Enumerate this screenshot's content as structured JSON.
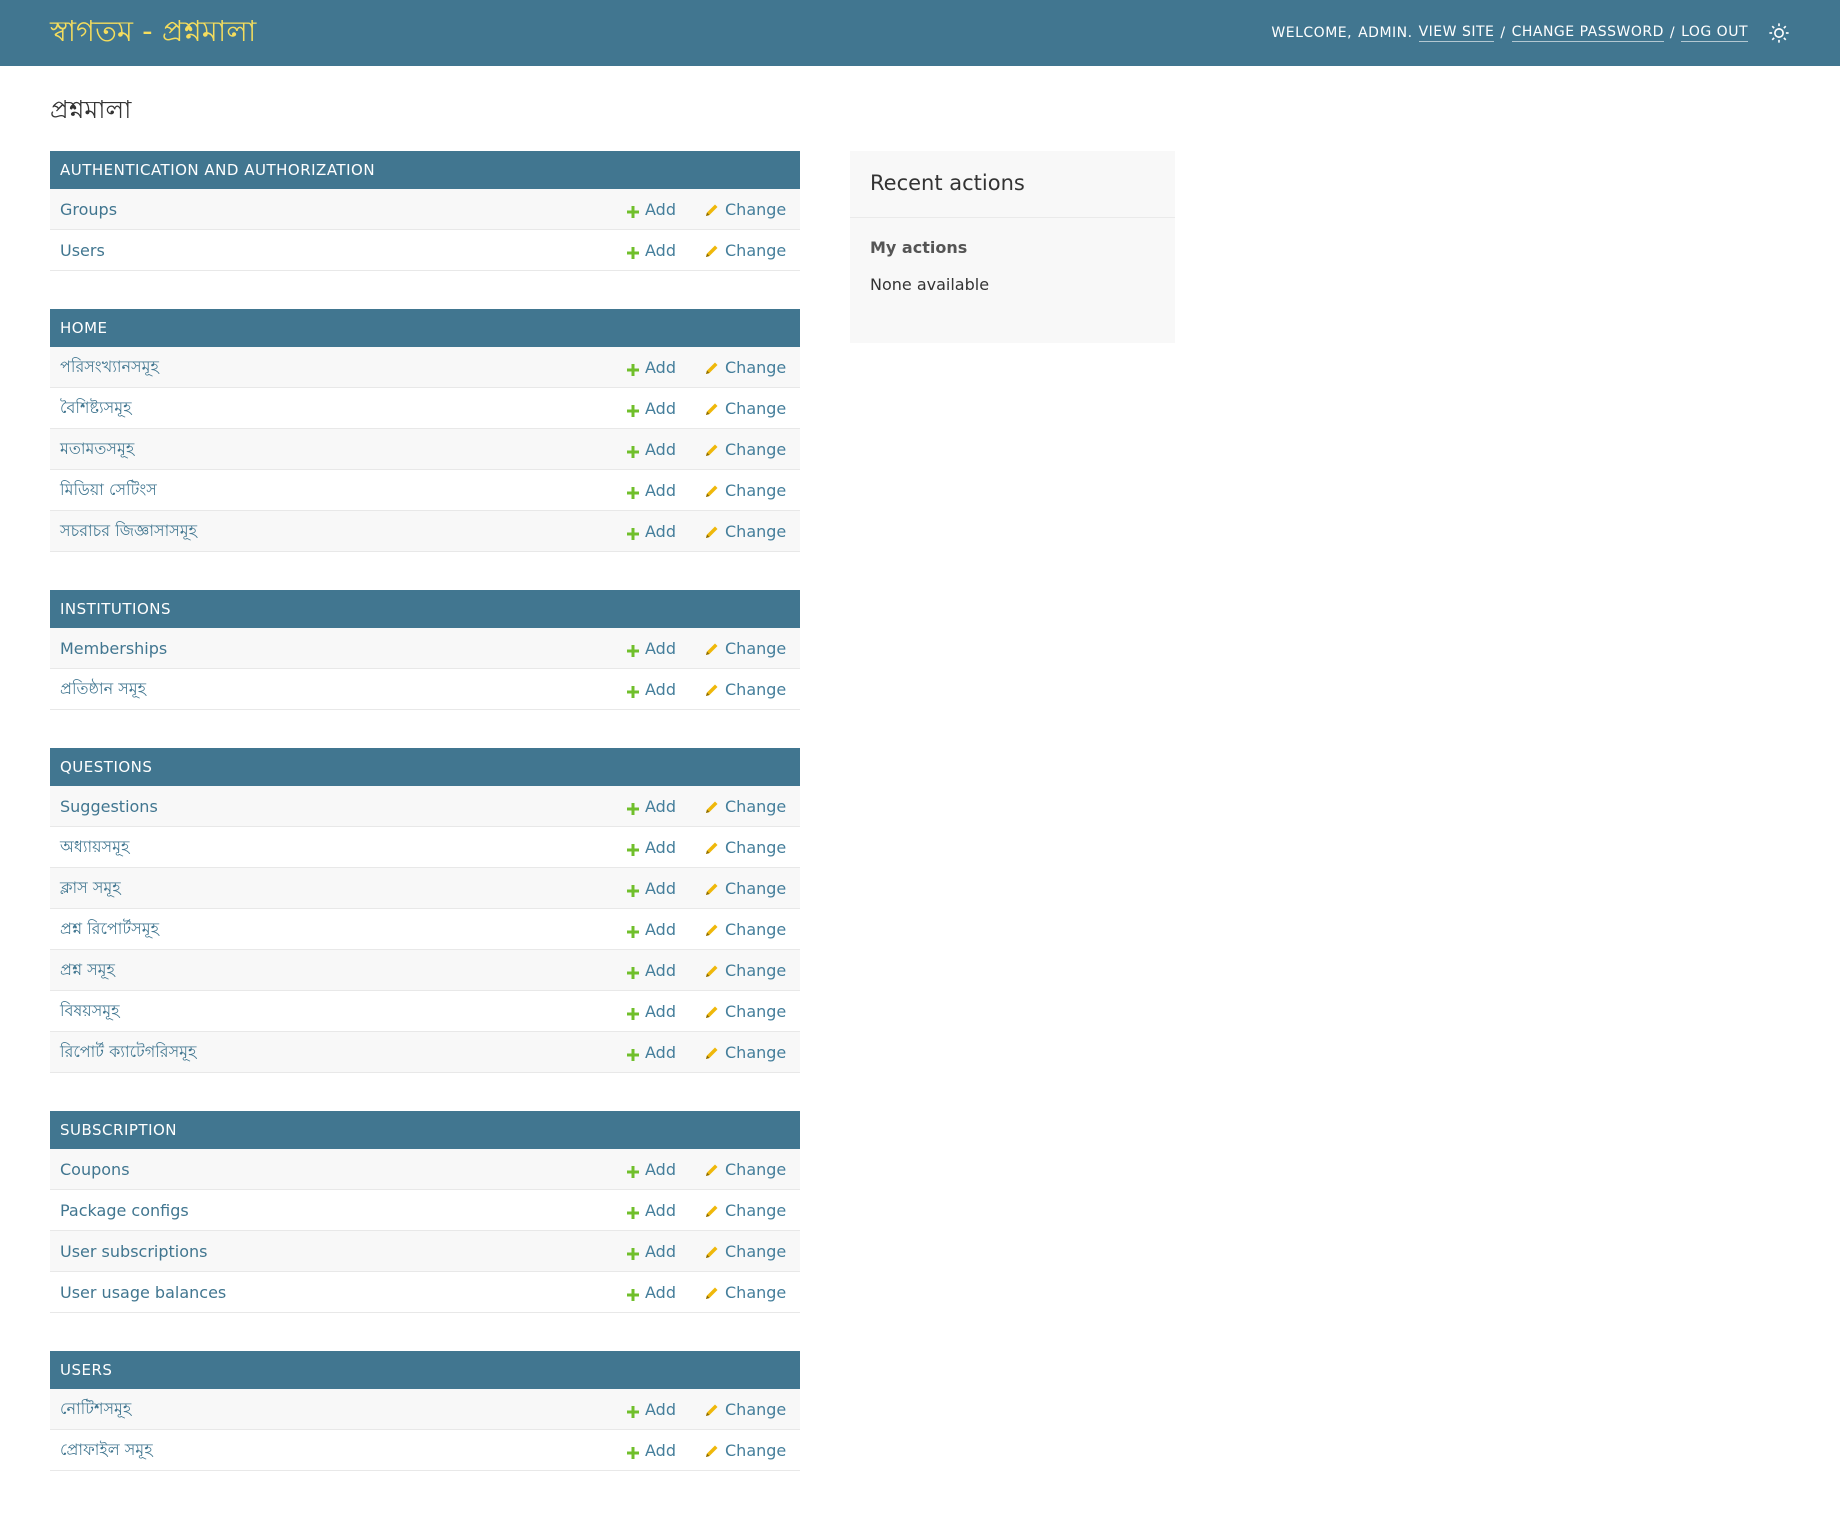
{
  "header": {
    "brand": "স্বাগতম - প্রশ্নমালা",
    "welcome": "WELCOME,",
    "username": "ADMIN.",
    "view_site": "VIEW SITE",
    "change_password": "CHANGE PASSWORD",
    "log_out": "LOG OUT",
    "sep": "/",
    "theme_icon": "sun-icon"
  },
  "page_title": "প্রশ্নমালা",
  "actions": {
    "add": "Add",
    "change": "Change"
  },
  "modules": [
    {
      "caption": "AUTHENTICATION AND AUTHORIZATION",
      "models": [
        "Groups",
        "Users"
      ]
    },
    {
      "caption": "HOME",
      "models": [
        "পরিসংখ্যানসমূহ",
        "বৈশিষ্ট্যসমূহ",
        "মতামতসমূহ",
        "মিডিয়া সেটিংস",
        "সচরাচর জিজ্ঞাসাসমূহ"
      ]
    },
    {
      "caption": "INSTITUTIONS",
      "models": [
        "Memberships",
        "প্রতিষ্ঠান সমূহ"
      ]
    },
    {
      "caption": "QUESTIONS",
      "models": [
        "Suggestions",
        "অধ্যায়সমূহ",
        "ক্লাস সমূহ",
        "প্রশ্ন রিপোর্টসমূহ",
        "প্রশ্ন সমূহ",
        "বিষয়সমূহ",
        "রিপোর্ট ক্যাটেগরিসমূহ"
      ]
    },
    {
      "caption": "SUBSCRIPTION",
      "models": [
        "Coupons",
        "Package configs",
        "User subscriptions",
        "User usage balances"
      ]
    },
    {
      "caption": "USERS",
      "models": [
        "নোটিশসমূহ",
        "প্রোফাইল সমূহ"
      ]
    }
  ],
  "recent_actions": {
    "title": "Recent actions",
    "my_actions": "My actions",
    "none": "None available"
  },
  "colors": {
    "header_bg": "#417690",
    "brand": "#f5dd5d",
    "link": "#417690",
    "add_icon": "#70bf2b",
    "change_icon": "#efb80b"
  }
}
